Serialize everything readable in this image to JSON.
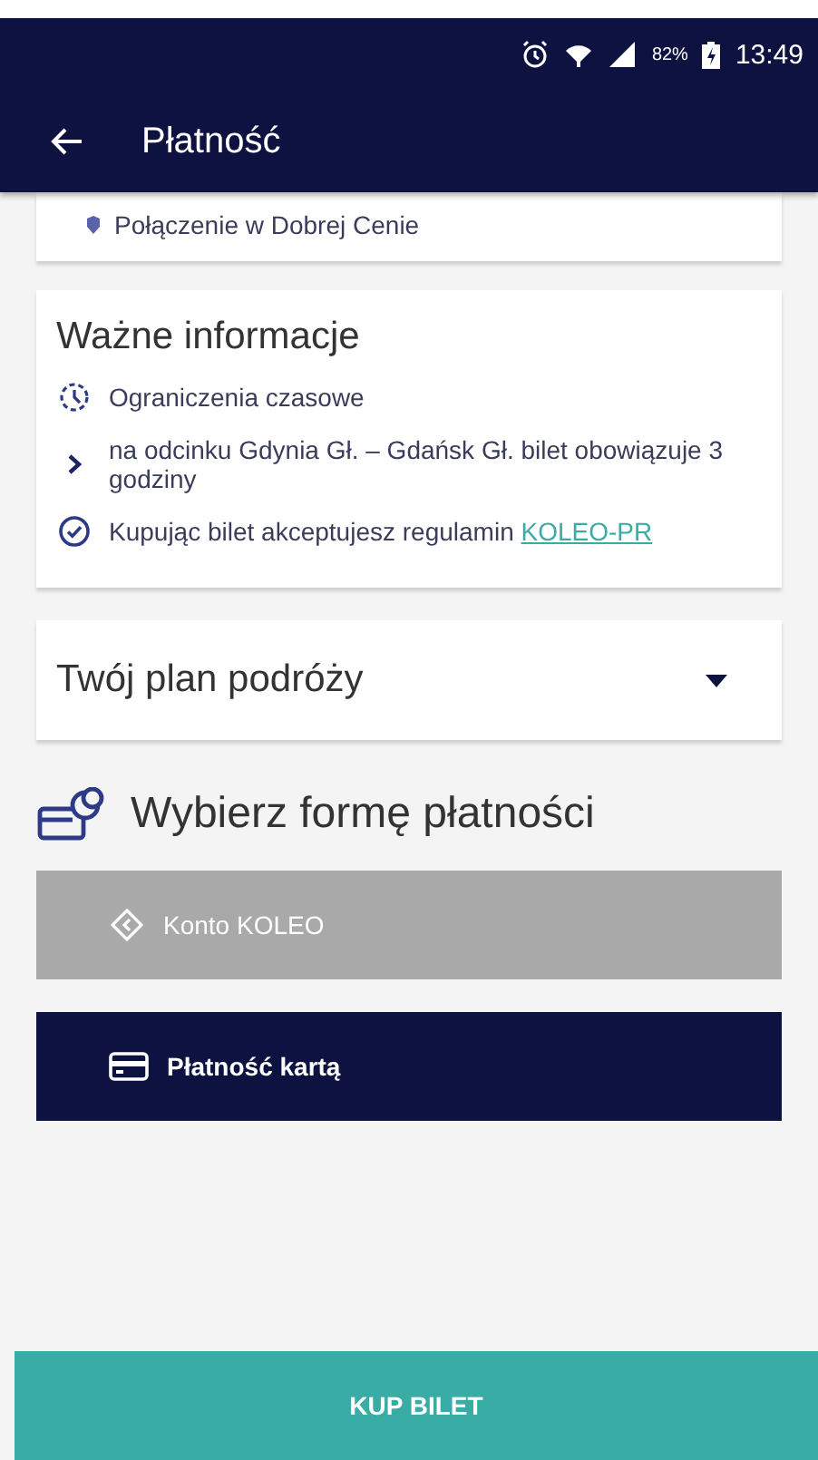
{
  "status_bar": {
    "battery_text": "82%",
    "time": "13:49"
  },
  "app_bar": {
    "title": "Płatność"
  },
  "connection_note": {
    "text": "Połączenie w Dobrej Cenie"
  },
  "important_info": {
    "title": "Ważne informacje",
    "items": [
      {
        "kind": "clock",
        "text": "Ograniczenia czasowe"
      },
      {
        "kind": "chevron",
        "text": "na odcinku Gdynia Gł. – Gdańsk Gł. bilet obowiązuje 3 godziny"
      },
      {
        "kind": "check",
        "text": "Kupując bilet akceptujesz regulamin",
        "link": "KOLEO-PR"
      }
    ]
  },
  "travel_plan": {
    "title": "Twój plan podróży",
    "expanded": false
  },
  "payment": {
    "title": "Wybierz formę płatności",
    "methods": [
      {
        "kind": "account",
        "label": "Konto KOLEO",
        "selected": false
      },
      {
        "kind": "card",
        "label": "Płatność kartą",
        "selected": true
      }
    ]
  },
  "buy_button": {
    "label": "KUP BILET"
  }
}
